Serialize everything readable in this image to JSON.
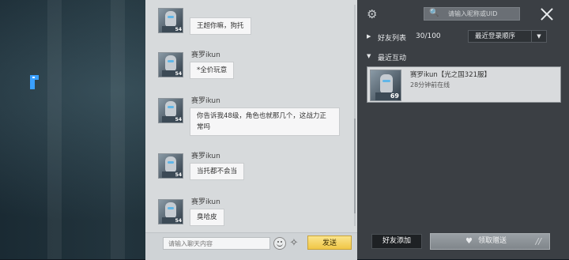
{
  "chat": {
    "messages": [
      {
        "name": "",
        "text": "王超你嘛，狗托",
        "level": "54"
      },
      {
        "name": "赛罗ikun",
        "text": "*全价玩意",
        "level": "54"
      },
      {
        "name": "赛罗ikun",
        "text": "你告诉我48级，角色也就那几个，这战力正常吗",
        "level": "54"
      },
      {
        "name": "赛罗ikun",
        "text": "当托都不会当",
        "level": "54"
      },
      {
        "name": "赛罗ikun",
        "text": "臭哈皮",
        "level": "54"
      }
    ],
    "input_placeholder": "请输入聊天内容",
    "send_label": "发送"
  },
  "friends": {
    "search_placeholder": "请输入昵称或UID",
    "list_label": "好友列表",
    "count": "30/100",
    "sort_selected": "最近登录顺序",
    "recent_label": "最近互动",
    "recent": [
      {
        "name": "赛罗ikun【光之国321服】",
        "status": "28分钟前在线",
        "level": "69"
      }
    ],
    "add_friend_label": "好友添加",
    "claim_gift_label": "领取赠送"
  }
}
